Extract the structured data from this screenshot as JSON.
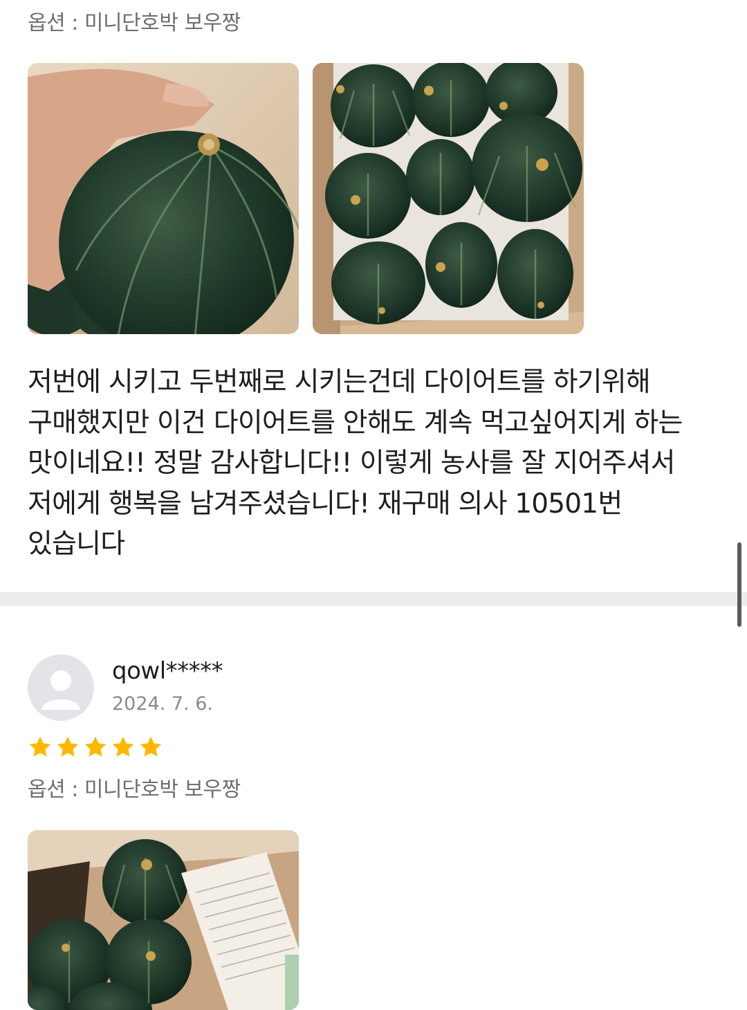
{
  "review_1": {
    "option": "옵션 : 미니단호박 보우짱",
    "body": "저번에 시키고 두번째로 시키는건데 다이어트를 하기위해 구매했지만 이건 다이어트를 안해도 계속 먹고싶어지게 하는 맛이네요!! 정말 감사합니다!! 이렇게 농사를 잘 지어주셔서 저에게 행복을 남겨주셨습니다! 재구매 의사 10501번 있습니다"
  },
  "review_2": {
    "reviewer": "qowl*****",
    "date": "2024. 7. 6.",
    "rating": 5,
    "option": "옵션 : 미니단호박 보우짱"
  },
  "colors": {
    "star": "#FFB800",
    "divider": "#ECECEF",
    "option_text": "#6E6E6E",
    "date_text": "#8A8A8A",
    "avatar_bg": "#E4E4E8",
    "avatar_fg": "#FFFFFF"
  },
  "icons": {
    "avatar": "default-user-avatar-icon",
    "rating": "star-icon"
  }
}
